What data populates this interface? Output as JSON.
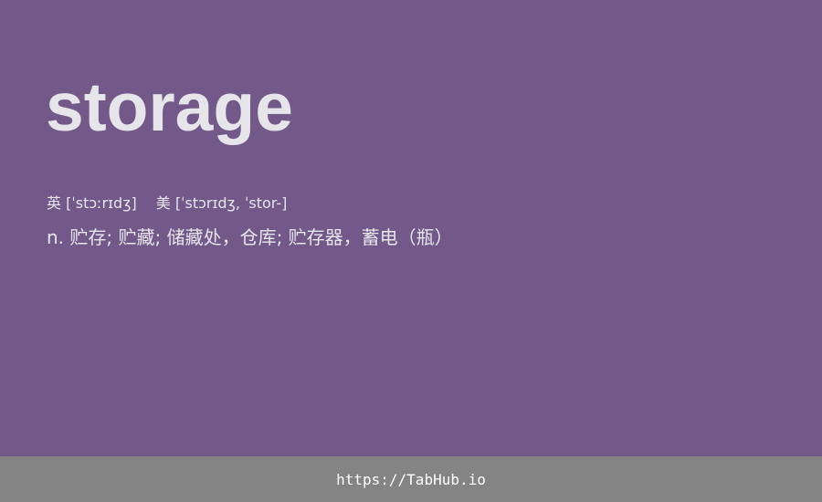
{
  "card": {
    "word": "storage",
    "phonetic_uk": "英 [ˈstɔːrɪdʒ]",
    "phonetic_us": "美 [ˈstɔrɪdʒ, ˈstor-]",
    "definition": "n. 贮存; 贮藏; 储藏处，仓库; 贮存器，蓄电（瓶）",
    "background_color": "#72598a",
    "text_color": "#e6e5ea"
  },
  "footer": {
    "link_text": "https://TabHub.io",
    "background_color": "#848484"
  }
}
